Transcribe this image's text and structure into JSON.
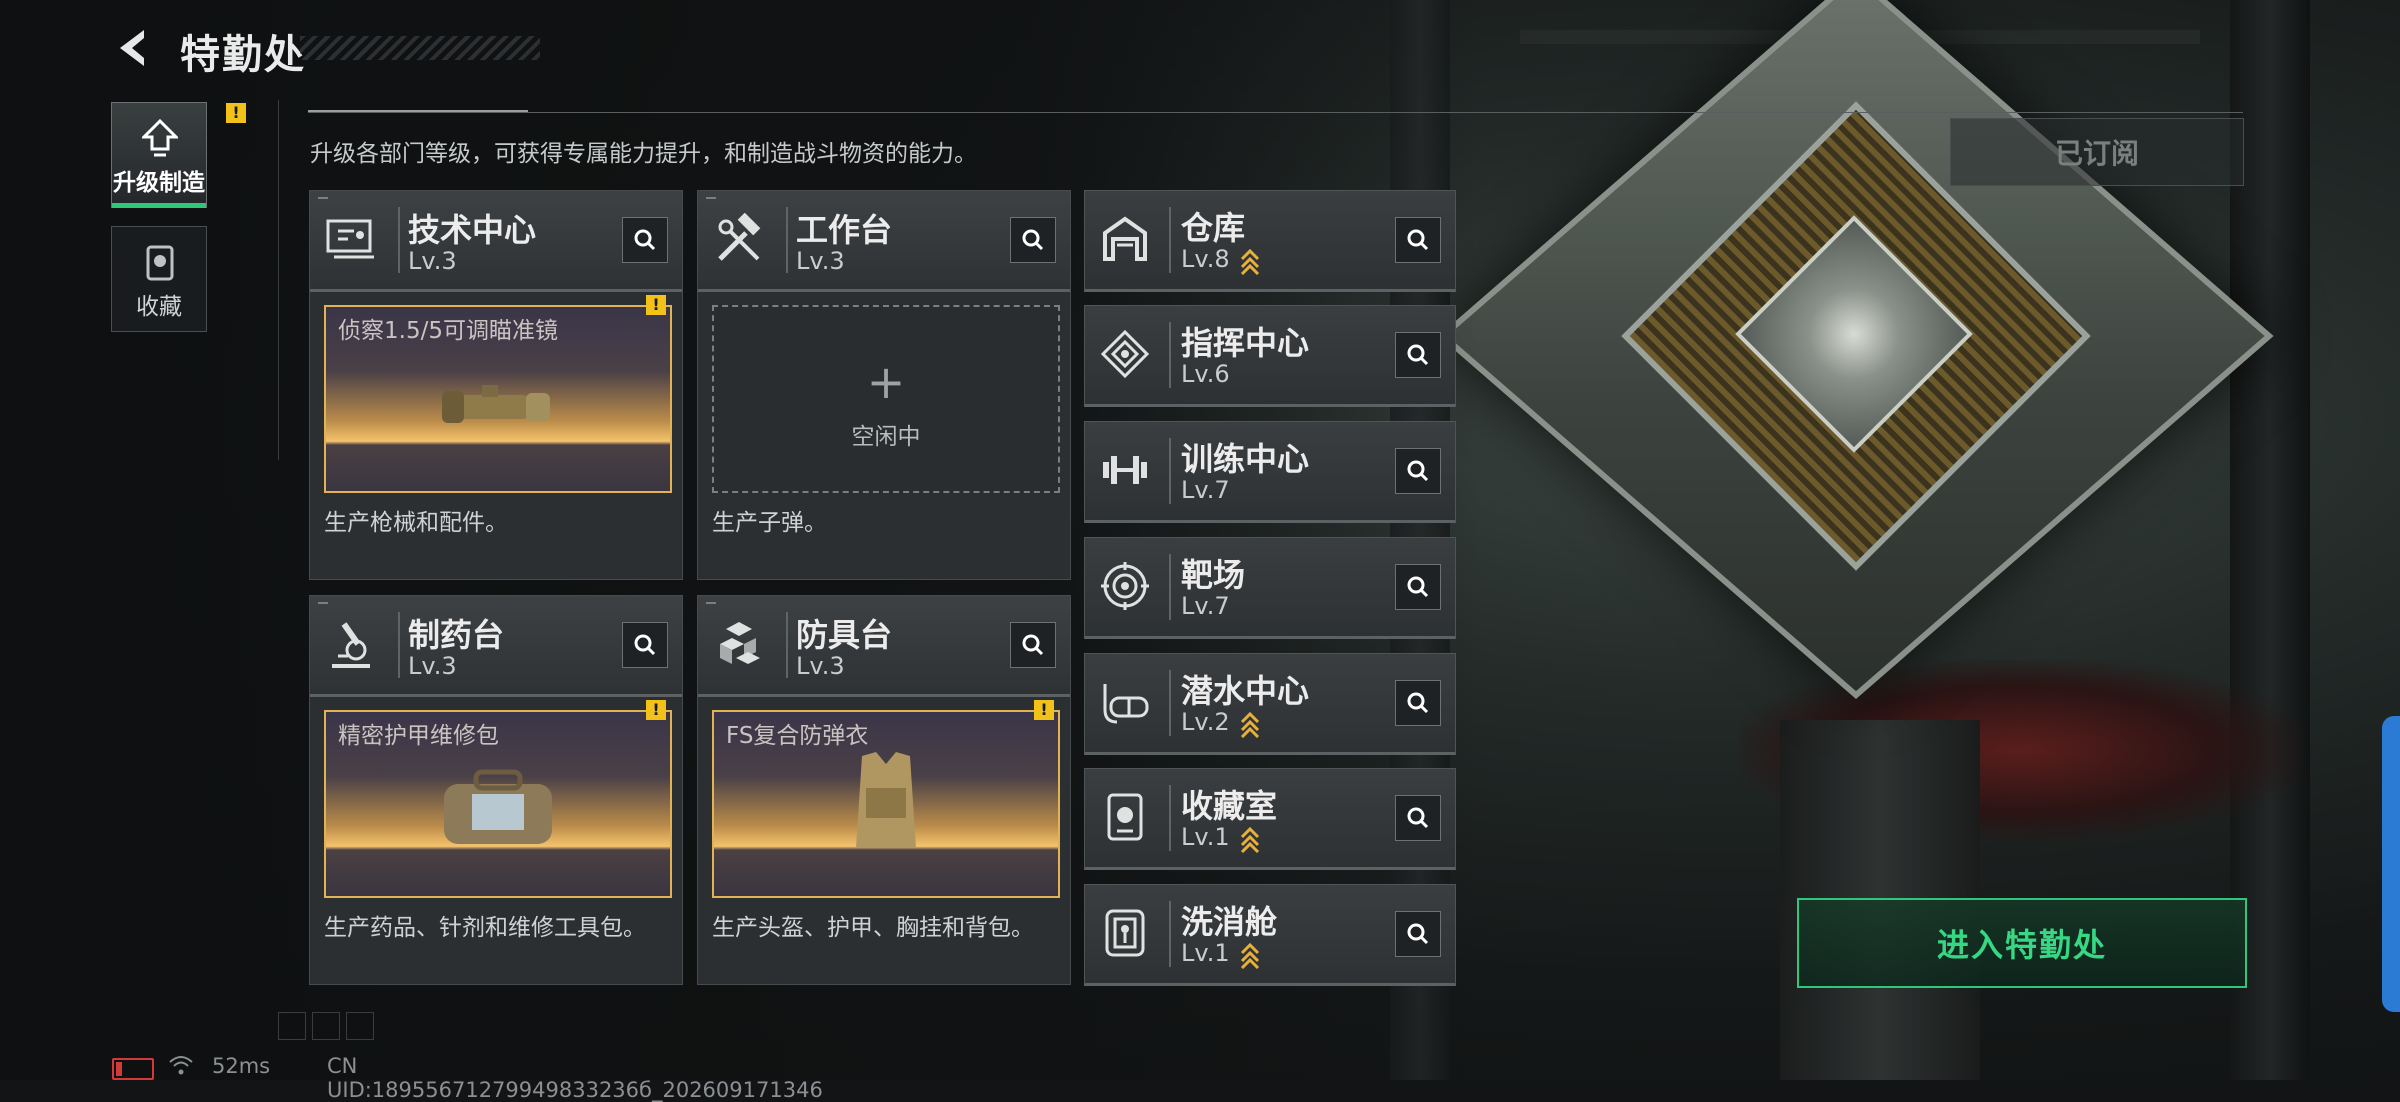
{
  "header": {
    "title": "特勤处"
  },
  "nav": [
    {
      "label": "升级制造",
      "active": true,
      "badge": "!"
    },
    {
      "label": "收藏",
      "active": false
    }
  ],
  "description": "升级各部门等级，可获得专属能力提升，和制造战斗物资的能力。",
  "subscribed_label": "已订阅",
  "cards": [
    {
      "name": "技术中心",
      "level": "Lv.3",
      "product": "侦察1.5/5可调瞄准镜",
      "desc": "生产枪械和配件。"
    },
    {
      "name": "工作台",
      "level": "Lv.3",
      "idle_label": "空闲中",
      "plus": "+",
      "desc": "生产子弹。"
    },
    {
      "name": "制药台",
      "level": "Lv.3",
      "product": "精密护甲维修包",
      "desc": "生产药品、针剂和维修工具包。"
    },
    {
      "name": "防具台",
      "level": "Lv.3",
      "product": "FS复合防弹衣",
      "desc": "生产头盔、护甲、胸挂和背包。"
    }
  ],
  "list": [
    {
      "name": "仓库",
      "level": "Lv.8",
      "upgradable": true
    },
    {
      "name": "指挥中心",
      "level": "Lv.6",
      "upgradable": false
    },
    {
      "name": "训练中心",
      "level": "Lv.7",
      "upgradable": false
    },
    {
      "name": "靶场",
      "level": "Lv.7",
      "upgradable": false
    },
    {
      "name": "潜水中心",
      "level": "Lv.2",
      "upgradable": true
    },
    {
      "name": "收藏室",
      "level": "Lv.1",
      "upgradable": true
    },
    {
      "name": "洗消舱",
      "level": "Lv.1",
      "upgradable": true
    }
  ],
  "enter_label": "进入特勤处",
  "status": {
    "ping": "52ms",
    "uid": "CN UID:18955671279949833236б_202609171346"
  },
  "colors": {
    "accent_green": "#2fc87b",
    "badge_yellow": "#f2c21b",
    "product_border": "#e2b355"
  }
}
